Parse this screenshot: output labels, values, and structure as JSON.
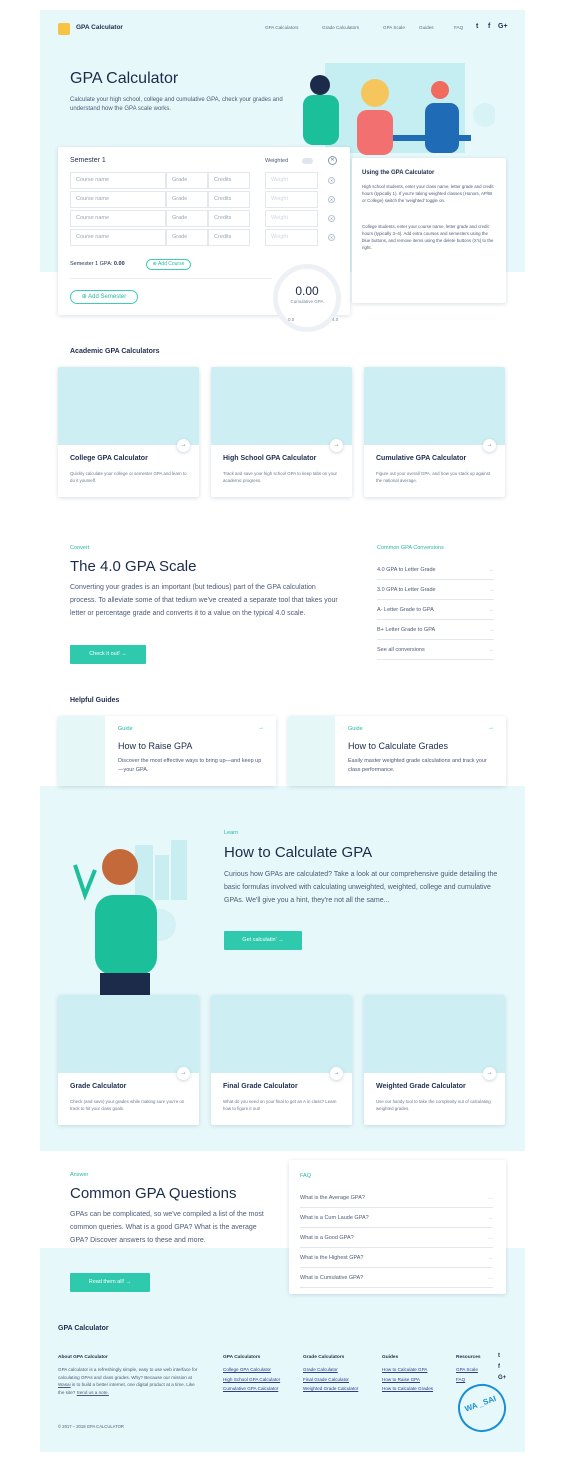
{
  "header": {
    "brand": "GPA Calculator",
    "nav": [
      "GPA Calculators",
      "Grade Calculators",
      "GPA Scale",
      "Guides",
      "FAQ"
    ],
    "social": [
      "twitter-icon",
      "facebook-icon",
      "google-plus-icon"
    ]
  },
  "hero": {
    "title": "GPA Calculator",
    "subtitle": "Calculate your high school, college and cumulative GPA, check your grades and understand how the GPA scale works."
  },
  "calculator": {
    "semester": "Semester 1",
    "weighted": "Weighted",
    "course_placeholder": "Course name",
    "grade_placeholder": "Grade",
    "credits_placeholder": "Credits",
    "weight_placeholder": "Weight",
    "semester_gpa_label": "Semester 1 GPA:",
    "semester_gpa": "0.00",
    "add_course": "Add Course",
    "add_semester": "Add Semester",
    "cumulative_value": "0.00",
    "cumulative_label": "Cumulative GPA",
    "scale_min": "0.0",
    "scale_max": "4.0"
  },
  "help": {
    "title": "Using the GPA Calculator",
    "p1": "High school students, enter your class name, letter grade and credit hours (typically 1). If you're taking weighted classes (Honors, AP/IB or College) switch the 'weighted' toggle on.",
    "p2": "College students, enter your course name, letter grade and credit hours (typically 3–4). Add extra courses and semesters using the blue buttons, and remove items using the delete buttons (X's) to the right."
  },
  "academic": {
    "title": "Academic GPA Calculators",
    "tiles": [
      {
        "title": "College GPA Calculator",
        "desc": "Quickly calculate your college or semester GPA and learn to do it yourself."
      },
      {
        "title": "High School GPA Calculator",
        "desc": "Track and save your high school GPA to keep tabs on your academic progress."
      },
      {
        "title": "Cumulative GPA Calculator",
        "desc": "Figure out your overall GPA, and how you stack up against the national average."
      }
    ]
  },
  "scale": {
    "kicker": "Convert",
    "title": "The 4.0 GPA Scale",
    "text": "Converting your grades is an important (but tedious) part of the GPA calculation process. To alleviate some of that tedium we've created a separate tool that takes your letter or percentage grade and converts it to a value on the typical 4.0 scale.",
    "button": "Check it out!",
    "conversions_title": "Common GPA Conversions",
    "conversions": [
      "4.0 GPA to Letter Grade",
      "3.0 GPA to Letter Grade",
      "A- Letter Grade to GPA",
      "B+ Letter Grade to GPA",
      "See all conversions"
    ]
  },
  "guides": {
    "title": "Helpful Guides",
    "items": [
      {
        "kicker": "Guide",
        "title": "How to Raise GPA",
        "desc": "Discover the most effective ways to bring up—and keep up—your GPA."
      },
      {
        "kicker": "Guide",
        "title": "How to Calculate Grades",
        "desc": "Easily master weighted grade calculations and track your class performance."
      }
    ]
  },
  "learn": {
    "kicker": "Learn",
    "title": "How to Calculate GPA",
    "text": "Curious how GPAs are calculated? Take a look at our comprehensive guide detailing the basic formulas involved with calculating unweighted, weighted, college and cumulative GPAs. We'll give you a hint, they're not all the same...",
    "button": "Get calculatin'"
  },
  "grade_tiles": [
    {
      "title": "Grade Calculator",
      "desc": "Check (and save) your grades while making sure you're on track to hit your class goals."
    },
    {
      "title": "Final Grade Calculator",
      "desc": "What do you need on your final to get an A in class? Learn how to figure it out!"
    },
    {
      "title": "Weighted Grade Calculator",
      "desc": "Use our handy tool to take the complexity out of calculating weighted grades."
    }
  ],
  "faq": {
    "kicker": "Answer",
    "title": "Common GPA Questions",
    "text": "GPAs can be complicated, so we've compiled a list of the most common queries. What is a good GPA? What is the average GPA? Discover answers to these and more.",
    "button": "Read them all!",
    "box_title": "FAQ",
    "questions": [
      "What is the Average GPA?",
      "What is a Cum Laude GPA?",
      "What is a Good GPA?",
      "What is the Highest GPA?",
      "What is Cumulative GPA?"
    ]
  },
  "footer": {
    "brand": "GPA Calculator",
    "about_title": "About GPA Calculator",
    "about_text": "GPA calculator is a refreshingly simple, easy to use web interface for calculating GPAs and class grades. Why? Because our mission at",
    "about_link": "Wasai",
    "about_text2": "is to build a better internet, one digital product at a time. Like the site?",
    "about_link2": "Send us a note.",
    "cols": [
      {
        "title": "GPA Calculators",
        "links": [
          "College GPA Calculator",
          "High School GPA Calculator",
          "Cumulative GPA Calculator"
        ]
      },
      {
        "title": "Grade Calculators",
        "links": [
          "Grade Calculator",
          "Final Grade Calculator",
          "Weighted Grade Calculator"
        ]
      },
      {
        "title": "Guides",
        "links": [
          "How to Calculate GPA",
          "How to Raise GPA",
          "How to Calculate Grades"
        ]
      },
      {
        "title": "Resources",
        "links": [
          "GPA Scale",
          "FAQ"
        ]
      }
    ],
    "copyright": "© 2017 – 2018 GPA CALCULATOR",
    "stamp": "WA _SAI"
  },
  "colors": {
    "accent": "#2fc9ad",
    "bg_tint": "#e7f8fa",
    "navy": "#1c2b4a"
  }
}
